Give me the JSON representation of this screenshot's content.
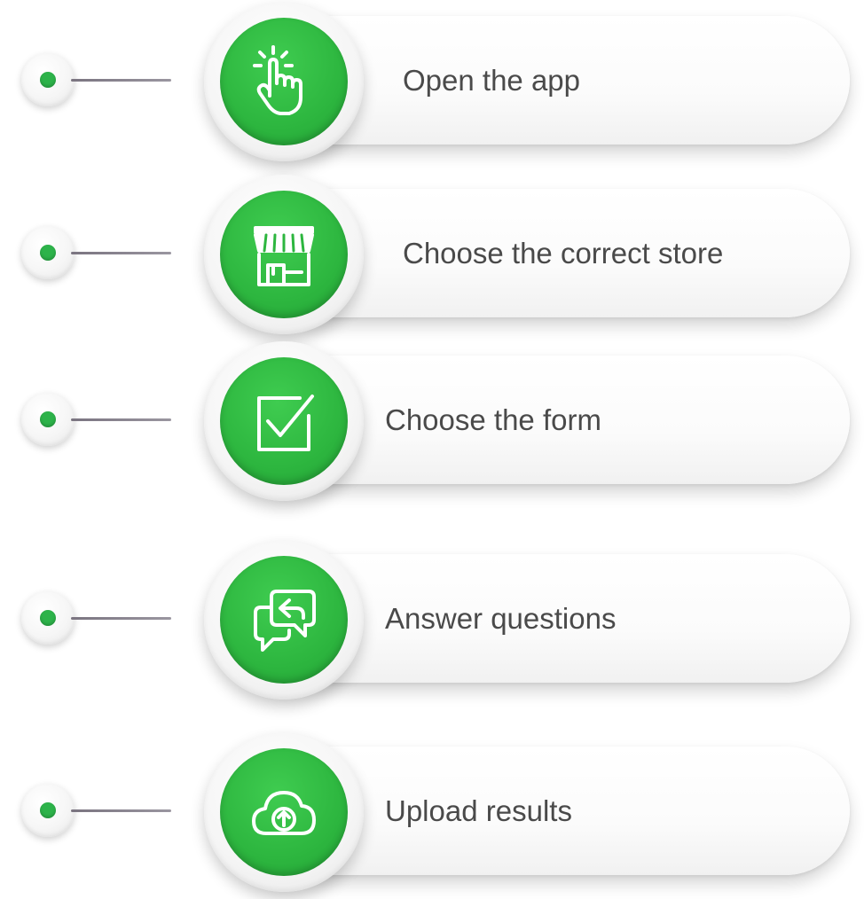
{
  "accent_color": "#2db34a",
  "steps": [
    {
      "label": "Open the app",
      "icon": "tap-hand-icon"
    },
    {
      "label": "Choose the correct store",
      "icon": "storefront-icon"
    },
    {
      "label": "Choose the form",
      "icon": "checkbox-icon"
    },
    {
      "label": "Answer questions",
      "icon": "chat-reply-icon"
    },
    {
      "label": "Upload results",
      "icon": "cloud-upload-icon"
    }
  ]
}
